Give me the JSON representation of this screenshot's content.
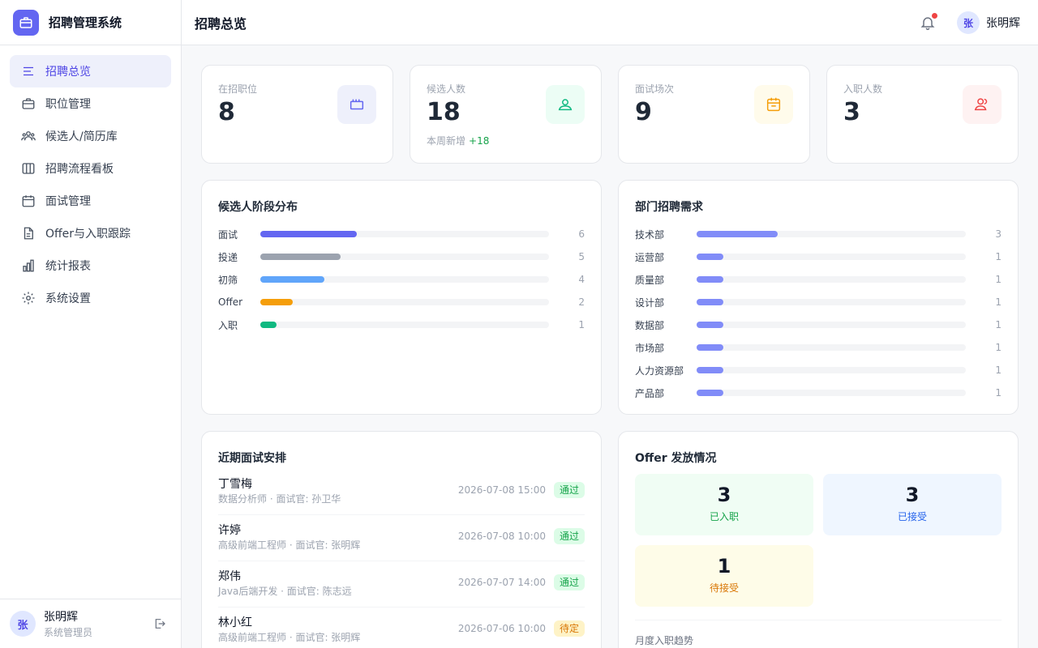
{
  "app": {
    "name": "招聘管理系统"
  },
  "header": {
    "title": "招聘总览",
    "user_name": "张明辉",
    "user_initial": "张"
  },
  "sidebar": {
    "items": [
      {
        "label": "招聘总览",
        "icon": "menu-lines-icon",
        "active": true
      },
      {
        "label": "职位管理",
        "icon": "briefcase-icon"
      },
      {
        "label": "候选人/简历库",
        "icon": "users-icon"
      },
      {
        "label": "招聘流程看板",
        "icon": "kanban-icon"
      },
      {
        "label": "面试管理",
        "icon": "calendar-icon"
      },
      {
        "label": "Offer与入职跟踪",
        "icon": "document-icon"
      },
      {
        "label": "统计报表",
        "icon": "bar-chart-icon"
      },
      {
        "label": "系统设置",
        "icon": "gear-icon"
      }
    ],
    "user": {
      "name": "张明辉",
      "role": "系统管理员",
      "initial": "张"
    }
  },
  "stats": [
    {
      "label": "在招职位",
      "value": "8",
      "icon": "briefcase-icon",
      "color": "#6366f1",
      "bg": "#eef0fb"
    },
    {
      "label": "候选人数",
      "value": "18",
      "sub": "本周新增",
      "sub_delta": "+18",
      "icon": "user-icon",
      "color": "#10b981",
      "bg": "#ecfdf5"
    },
    {
      "label": "面试场次",
      "value": "9",
      "icon": "calendar-icon",
      "color": "#f59e0b",
      "bg": "#fffbeb"
    },
    {
      "label": "入职人数",
      "value": "3",
      "icon": "user-check-icon",
      "color": "#ef4444",
      "bg": "#fef2f2"
    }
  ],
  "stages": {
    "title": "候选人阶段分布",
    "max": 18,
    "items": [
      {
        "label": "面试",
        "count": 6,
        "color": "#6366f1"
      },
      {
        "label": "投递",
        "count": 5,
        "color": "#9ca3af"
      },
      {
        "label": "初筛",
        "count": 4,
        "color": "#60a5fa"
      },
      {
        "label": "Offer",
        "count": 2,
        "color": "#f59e0b"
      },
      {
        "label": "入职",
        "count": 1,
        "color": "#10b981"
      }
    ]
  },
  "departments": {
    "title": "部门招聘需求",
    "max": 10,
    "color": "#818cf8",
    "items": [
      {
        "label": "技术部",
        "count": 3
      },
      {
        "label": "运营部",
        "count": 1
      },
      {
        "label": "质量部",
        "count": 1
      },
      {
        "label": "设计部",
        "count": 1
      },
      {
        "label": "数据部",
        "count": 1
      },
      {
        "label": "市场部",
        "count": 1
      },
      {
        "label": "人力资源部",
        "count": 1
      },
      {
        "label": "产品部",
        "count": 1
      }
    ]
  },
  "interviews": {
    "title": "近期面试安排",
    "items": [
      {
        "name": "丁雪梅",
        "detail": "数据分析师 · 面试官: 孙卫华",
        "time": "2026-07-08 15:00",
        "status": "通过",
        "status_type": "pass"
      },
      {
        "name": "许婷",
        "detail": "高级前端工程师 · 面试官: 张明辉",
        "time": "2026-07-08 10:00",
        "status": "通过",
        "status_type": "pass"
      },
      {
        "name": "郑伟",
        "detail": "Java后端开发 · 面试官: 陈志远",
        "time": "2026-07-07 14:00",
        "status": "通过",
        "status_type": "pass"
      },
      {
        "name": "林小红",
        "detail": "高级前端工程师 · 面试官: 张明辉",
        "time": "2026-07-06 10:00",
        "status": "待定",
        "status_type": "wait"
      }
    ]
  },
  "offers": {
    "title": "Offer 发放情况",
    "items": [
      {
        "value": "3",
        "label": "已入职",
        "bg": "#f0fdf4",
        "color": "#16a34a"
      },
      {
        "value": "3",
        "label": "已接受",
        "bg": "#eff6ff",
        "color": "#2563eb"
      },
      {
        "value": "1",
        "label": "待接受",
        "bg": "#fefce8",
        "color": "#d97706"
      }
    ],
    "trend_label": "月度入职趋势"
  }
}
